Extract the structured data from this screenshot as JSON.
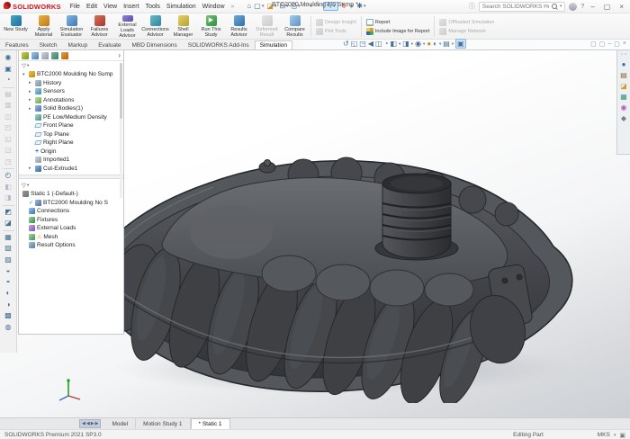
{
  "titlebar": {
    "logo_text": "SOLIDWORKS",
    "menus": [
      "File",
      "Edit",
      "View",
      "Insert",
      "Tools",
      "Simulation",
      "Window"
    ],
    "title": "BTC2000 Moulding No Sump *",
    "search_placeholder": "Search SOLIDWORKS Help",
    "help_label": "?"
  },
  "ribbon": {
    "buttons": [
      "New Study",
      "Apply Material",
      "Simulation Evaluator",
      "Failures Advisor",
      "External Loads Advisor",
      "Connections Advisor",
      "Shell Manager",
      "Run This Study",
      "Results Advisor",
      "Deformed Result",
      "Compare Results"
    ],
    "small_group": [
      "Design Insight",
      "Plot Tools"
    ],
    "report_group": [
      "Report",
      "Include Image for Report"
    ],
    "right_group": [
      "Offloaded Simulation",
      "Manage Network"
    ]
  },
  "tabs": [
    "Features",
    "Sketch",
    "Markup",
    "Evaluate",
    "MBD Dimensions",
    "SOLIDWORKS Add-Ins",
    "Simulation"
  ],
  "feature_tree": {
    "root": "BTC2000 Moulding No Sump",
    "items": [
      "History",
      "Sensors",
      "Annotations",
      "Solid Bodies(1)",
      "PE Low/Medium Density",
      "Front Plane",
      "Top Plane",
      "Right Plane",
      "Origin",
      "Imported1",
      "Cut-Extrude1"
    ]
  },
  "study_tree": {
    "root": "Static 1 (-Default-)",
    "items": [
      "BTC2000 Moulding No S",
      "Connections",
      "Fixtures",
      "External Loads",
      "Mesh",
      "Result Options"
    ]
  },
  "bottom": {
    "tabs": [
      "Model",
      "Motion Study 1",
      "* Static 1"
    ],
    "status_left": "SOLIDWORKS Premium 2021 SP3.0",
    "status_mode": "Editing Part",
    "status_units": "MKS"
  },
  "icons": {
    "caret": "▾",
    "home": "⌂",
    "new": "▢",
    "open": "◪",
    "save": "⊟",
    "print": "⎙",
    "undo": "↶",
    "redo": "↷",
    "select": "↖",
    "rebuild": "↻",
    "appearance": "●",
    "options": "✱",
    "info": "ⓘ",
    "min": "–",
    "max": "▢",
    "close": "×",
    "flyout": "›",
    "filter": "▽",
    "warning": "⚠",
    "check": "✓",
    "run": "▶",
    "pin": "»",
    "headsup": [
      "↺",
      "◱",
      "◳",
      "◀",
      "◫",
      "◔",
      "◧",
      "◨",
      "◉",
      "●",
      "◐",
      "▤",
      "▣"
    ],
    "leftstrip": [
      "◉",
      "▣",
      "◔",
      "▤",
      "▥",
      "◫",
      "◰",
      "◱",
      "◲",
      "◳",
      "◴",
      "◧",
      "◨",
      "◩",
      "◪",
      "▦",
      "▧",
      "▨",
      "◒",
      "◓",
      "◐",
      "◑",
      "▩",
      "◍"
    ],
    "taskpane": [
      "●",
      "▤",
      "◪",
      "▦",
      "◉",
      "◆"
    ],
    "sheetnav": [
      "◀",
      "◀",
      "▶",
      "▶"
    ],
    "docwin": [
      "▢",
      "▢",
      "–",
      "▢",
      "×"
    ]
  },
  "colors": {
    "accent": "#2f7bc4",
    "logo_red": "#d6121b",
    "model_dark": "#3d3f43",
    "model_light": "#5a5d62"
  }
}
